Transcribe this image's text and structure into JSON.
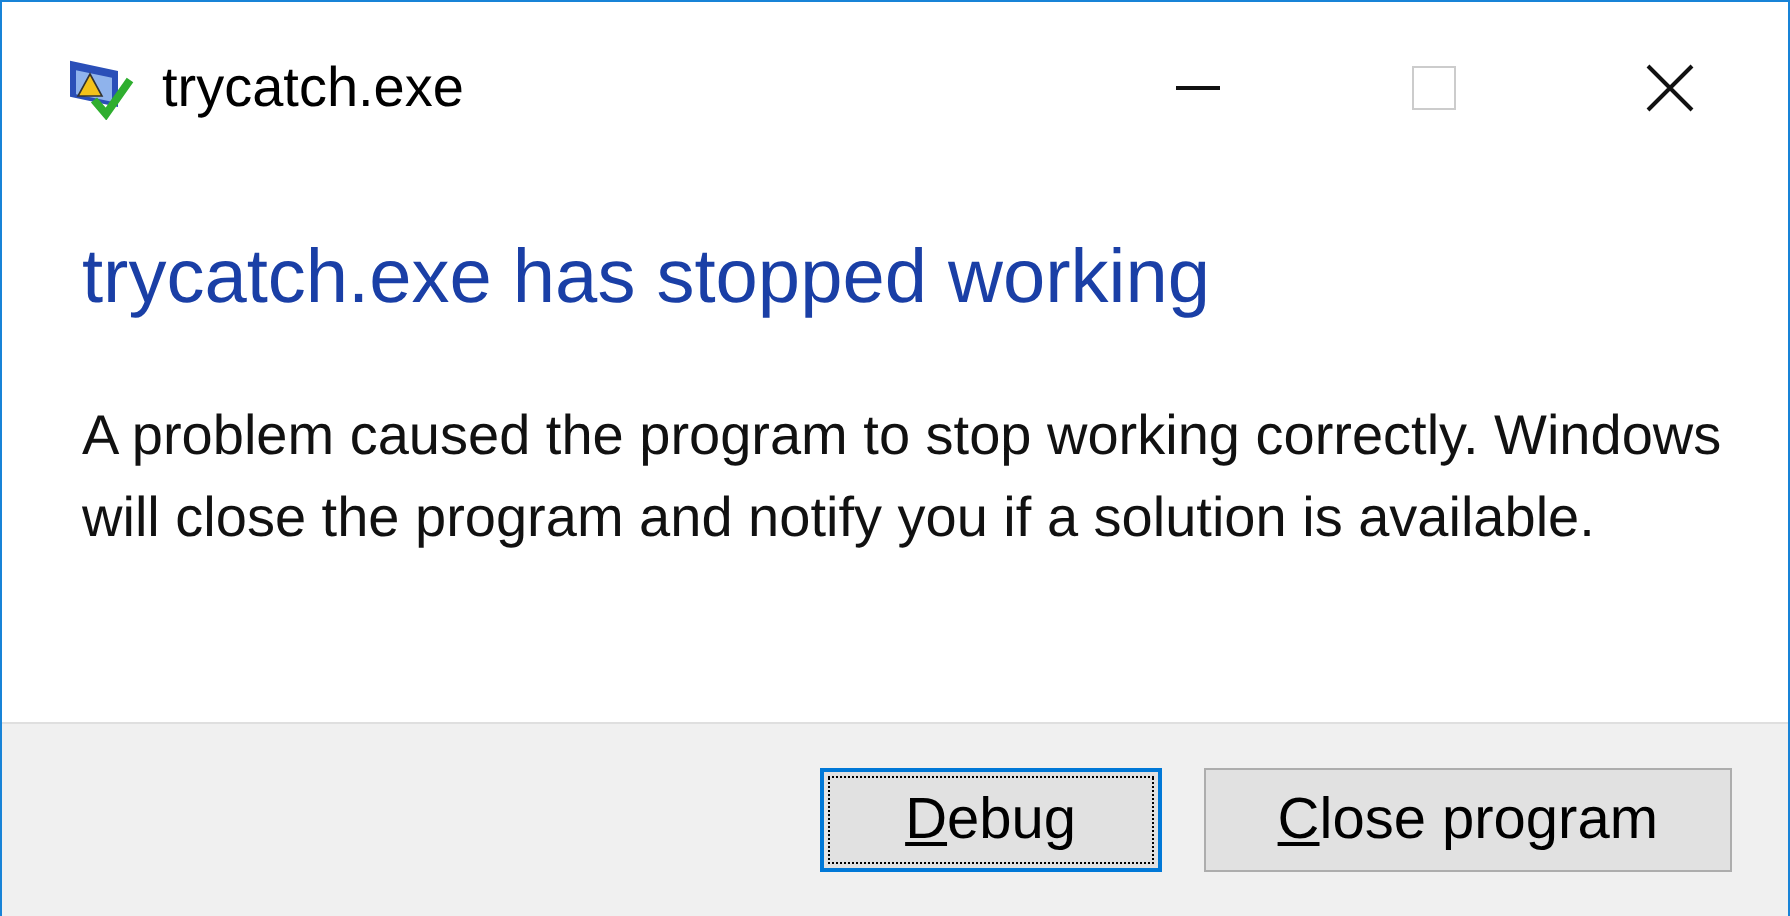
{
  "window": {
    "title": "trycatch.exe",
    "maximize_disabled": true
  },
  "heading": "trycatch.exe has stopped working",
  "message": "A problem caused the program to stop working correctly. Windows will close the program and notify you if a solution is available.",
  "buttons": [
    {
      "label": "Debug",
      "focused": true
    },
    {
      "label": "Close program",
      "focused": false
    }
  ]
}
